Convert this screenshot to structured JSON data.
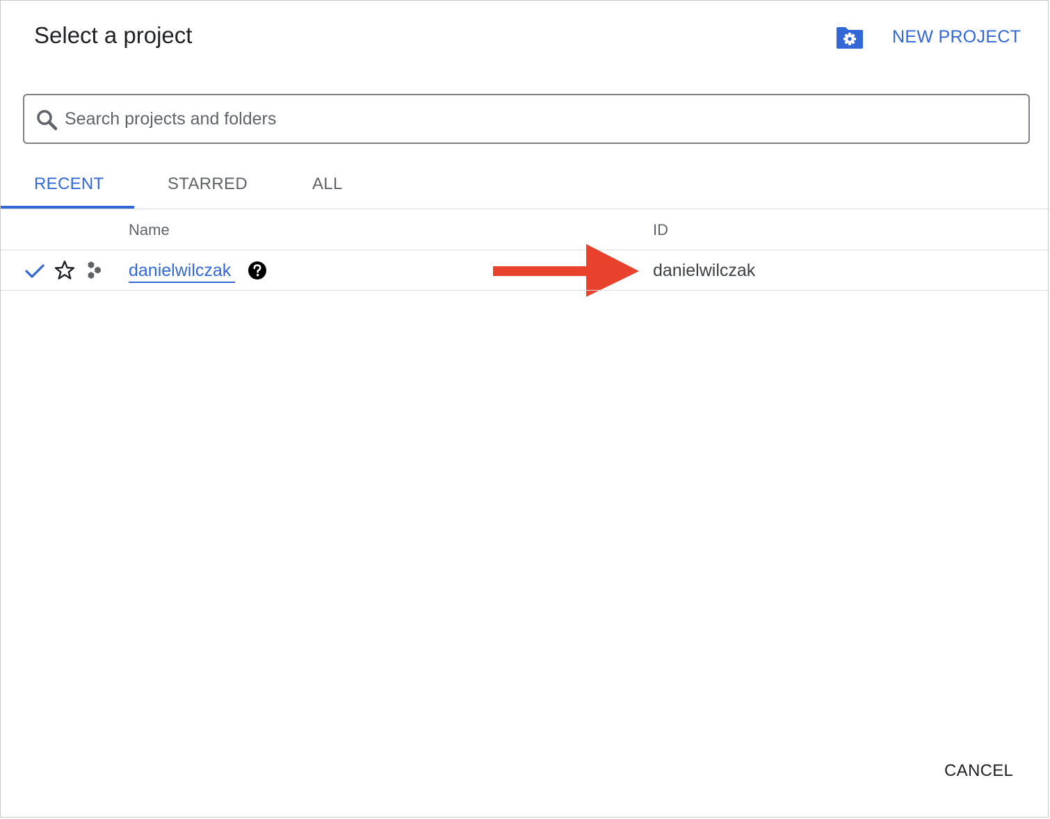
{
  "dialog": {
    "title": "Select a project",
    "new_project_label": "NEW PROJECT",
    "cancel_label": "CANCEL"
  },
  "search": {
    "placeholder": "Search projects and folders",
    "value": ""
  },
  "tabs": [
    {
      "label": "RECENT",
      "active": true
    },
    {
      "label": "STARRED",
      "active": false
    },
    {
      "label": "ALL",
      "active": false
    }
  ],
  "table": {
    "columns": [
      "Name",
      "ID"
    ],
    "rows": [
      {
        "name": "danielwilczak",
        "id": "danielwilczak",
        "selected": true,
        "starred": false
      }
    ]
  },
  "colors": {
    "accent": "#3367d6",
    "annotation_arrow": "#e8412c",
    "text_primary": "#202124",
    "text_secondary": "#5f6368"
  },
  "icons": {
    "folder_settings": "folder-settings-icon",
    "search": "search-icon",
    "check": "check-icon",
    "star": "star-outline-icon",
    "project_type": "hexagon-cluster-icon",
    "help": "help-circle-icon",
    "annotation": "red-arrow-icon"
  }
}
